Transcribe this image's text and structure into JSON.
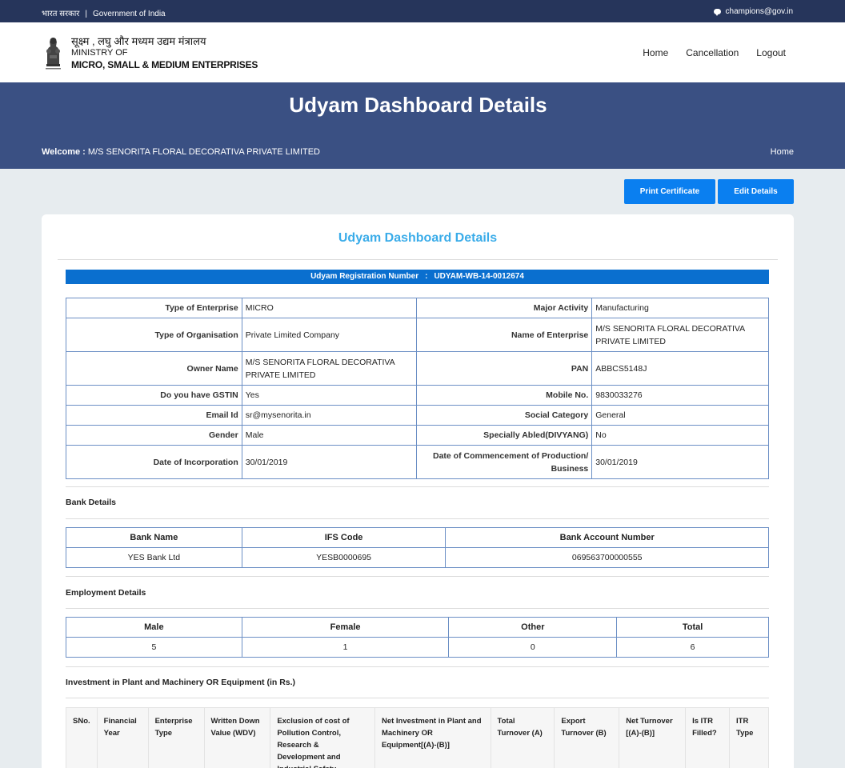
{
  "gov_strip": {
    "hindi": "भारत सरकार",
    "separator": "|",
    "english": "Government of India",
    "email": "champions@gov.in"
  },
  "header": {
    "ministry_hindi": "सूक्ष्म , लघु और मध्यम उद्यम मंत्रालय",
    "ministry_line1": "MINISTRY OF",
    "ministry_line2": "MICRO, SMALL & MEDIUM ENTERPRISES",
    "nav": [
      "Home",
      "Cancellation",
      "Logout"
    ]
  },
  "banner": {
    "title": "Udyam Dashboard Details",
    "welcome_label": "Welcome :",
    "welcome_name": "M/S SENORITA FLORAL DECORATIVA PRIVATE LIMITED",
    "breadcrumb": "Home"
  },
  "actions": {
    "print": "Print Certificate",
    "edit": "Edit Details"
  },
  "card": {
    "title": "Udyam Dashboard Details",
    "reg_label": "Udyam Registration Number",
    "reg_colon": ":",
    "reg_number": "UDYAM-WB-14-0012674"
  },
  "details": [
    [
      "Type of Enterprise",
      "MICRO",
      "Major Activity",
      "Manufacturing"
    ],
    [
      "Type of Organisation",
      "Private Limited Company",
      "Name of Enterprise",
      "M/S SENORITA FLORAL DECORATIVA PRIVATE LIMITED"
    ],
    [
      "Owner Name",
      "M/S SENORITA FLORAL DECORATIVA PRIVATE LIMITED",
      "PAN",
      "ABBCS5148J"
    ],
    [
      "Do you have GSTIN",
      "Yes",
      "Mobile No.",
      "9830033276"
    ],
    [
      "Email Id",
      "sr@mysenorita.in",
      "Social Category",
      "General"
    ],
    [
      "Gender",
      "Male",
      "Specially Abled(DIVYANG)",
      "No"
    ],
    [
      "Date of Incorporation",
      "30/01/2019",
      "Date of Commencement of Production/ Business",
      "30/01/2019"
    ]
  ],
  "bank": {
    "title": "Bank Details",
    "headers": [
      "Bank Name",
      "IFS Code",
      "Bank Account Number"
    ],
    "row": [
      "YES Bank Ltd",
      "YESB0000695",
      "069563700000555"
    ]
  },
  "employment": {
    "title": "Employment Details",
    "headers": [
      "Male",
      "Female",
      "Other",
      "Total"
    ],
    "row": [
      "5",
      "1",
      "0",
      "6"
    ]
  },
  "investment": {
    "title": "Investment in Plant and Machinery OR Equipment (in Rs.)",
    "headers": [
      "SNo.",
      "Financial Year",
      "Enterprise Type",
      "Written Down Value (WDV)",
      "Exclusion of cost of Pollution Control, Research & Development and Industrial Safety",
      "Net Investment in Plant and Machinery OR Equipment[(A)-(B)]",
      "Total Turnover (A)",
      "Export Turnover (B)",
      "Net Turnover [(A)-(B)]",
      "Is ITR Filled?",
      "ITR Type"
    ]
  }
}
